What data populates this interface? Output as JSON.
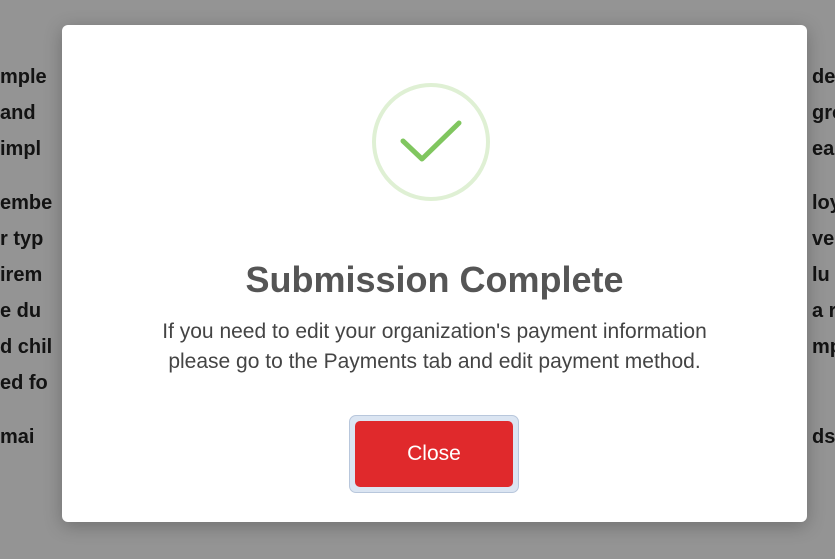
{
  "background": {
    "left_fragments": [
      "mple",
      "and",
      "impl",
      "embe",
      "r typ",
      "irem",
      "e du",
      "d chil",
      "ed fo",
      "mai"
    ],
    "right_fragments": [
      "de",
      "gro",
      "ea",
      "loy",
      "ve",
      "lu",
      "a r",
      "mp",
      "",
      "ds"
    ]
  },
  "modal": {
    "title": "Submission Complete",
    "message_line1": "If you need to edit your organization's payment information",
    "message_line2": "please go to the Payments tab and edit payment method.",
    "close_label": "Close"
  },
  "colors": {
    "close_button": "#e0292c",
    "check_stroke": "#80c65f",
    "icon_ring": "#dff0d4",
    "overlay": "rgba(0,0,0,0.42)"
  }
}
